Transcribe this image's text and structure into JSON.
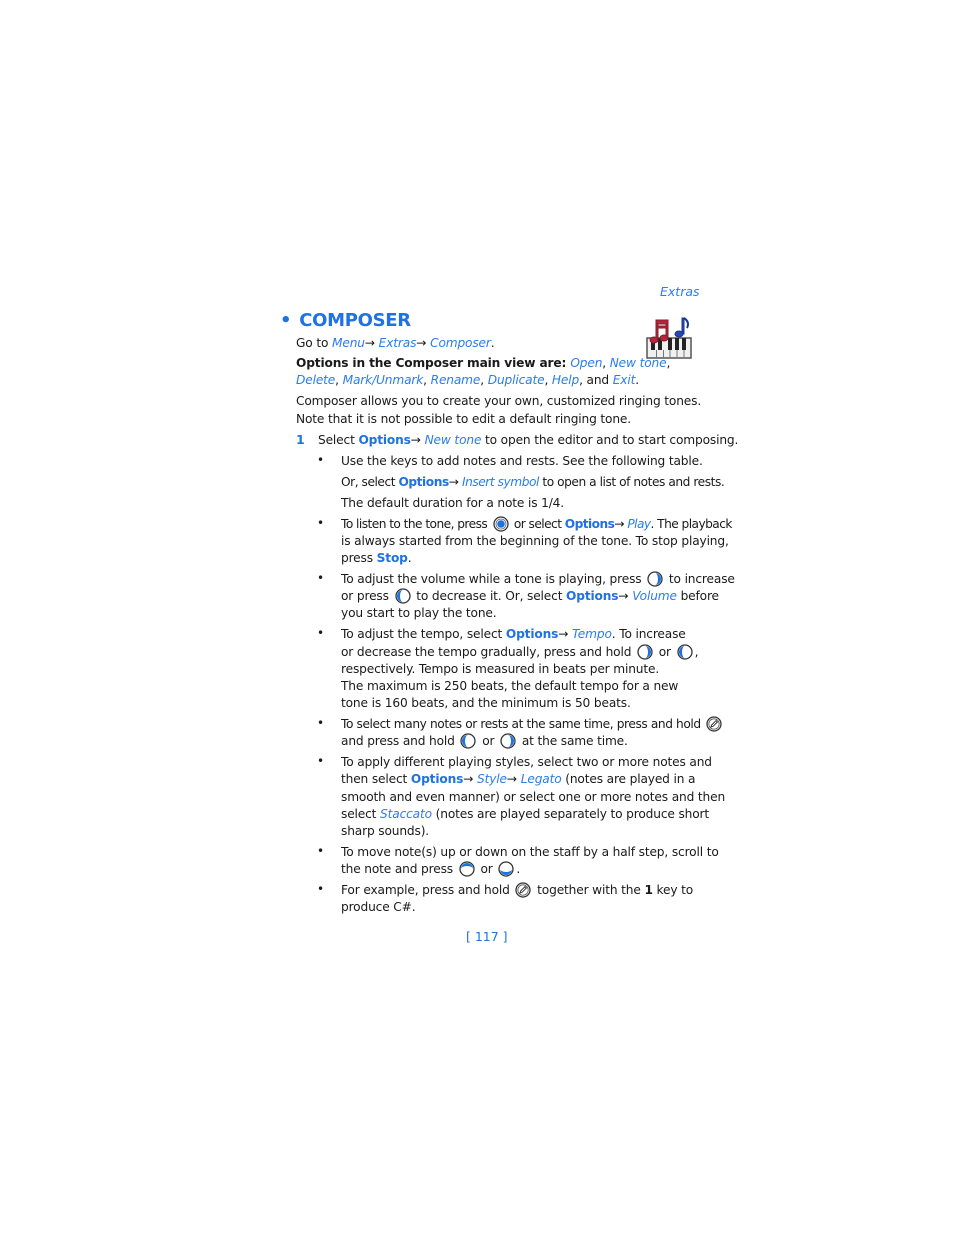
{
  "header": {
    "section": "Extras"
  },
  "title": {
    "bullet": "•",
    "text": "COMPOSER"
  },
  "app_icon": "composer-music-keyboard-icon",
  "goto": {
    "prefix": "Go to ",
    "path": [
      "Menu",
      "Extras",
      "Composer"
    ],
    "arrow": "→",
    "suffix": "."
  },
  "options_intro": {
    "label": "Options in the Composer main view are: ",
    "items": [
      "Open",
      "New tone",
      "Delete",
      "Mark/Unmark",
      "Rename",
      "Duplicate",
      "Help",
      "Exit"
    ],
    "and": "and"
  },
  "intro_paragraph": [
    "Composer allows you to create your own, customized ringing tones.",
    "Note that it is not possible to edit a default ringing tone."
  ],
  "step1": {
    "number": "1",
    "pre": "Select ",
    "options": "Options",
    "arrow": "→ ",
    "item": "New tone",
    "post": " to open the editor and to start composing."
  },
  "bullets": {
    "b1": {
      "l1": "Use the keys to add notes and rests. See the following table.",
      "l2_pre": "Or, select ",
      "l2_options": "Options",
      "l2_item": "Insert symbol",
      "l2_post": " to open a list of notes and rests.",
      "l3": "The default duration for a note is 1/4."
    },
    "b2": {
      "l1_pre": "To listen to the tone, press ",
      "l1_key": "joystick-press-icon",
      "l1_mid": " or select ",
      "l1_options": "Options",
      "l1_item": "Play",
      "l1_post": ". The playback",
      "l2": "is always started from the beginning of the tone. To stop playing,",
      "l3_pre": "press ",
      "l3_stop": "Stop",
      "l3_post": "."
    },
    "b3": {
      "l1_pre": "To adjust the volume while a tone is playing, press ",
      "l1_post": " to increase",
      "l2_pre": "or press ",
      "l2_mid": " to decrease it. Or, select ",
      "l2_options": "Options",
      "l2_item": "Volume",
      "l2_post": " before",
      "l3": "you start to play the tone."
    },
    "b4": {
      "l1_pre": "To adjust the tempo, select ",
      "l1_options": "Options",
      "l1_item": "Tempo",
      "l1_post": ". To increase",
      "l2_pre": "or decrease the tempo gradually, press and hold ",
      "l2_or": " or ",
      "l2_post": ",",
      "l3": "respectively. Tempo is measured in beats per minute.",
      "l4": "The maximum is 250 beats, the default tempo for a new",
      "l5": "tone is 160 beats, and the minimum is 50 beats."
    },
    "b5": {
      "l1_pre": "To select many notes or rests at the same time, press and hold ",
      "l2_pre": "and press and hold ",
      "l2_or": " or ",
      "l2_post": " at the same time."
    },
    "b6": {
      "l1": "To apply different playing styles, select two or more notes and",
      "l2_pre": "then select ",
      "l2_options": "Options",
      "l2_style": "Style",
      "l2_legato": "Legato",
      "l2_post": " (notes are played in a",
      "l3": "smooth and even manner) or select one or more notes and then",
      "l4_pre": "select ",
      "l4_item": "Staccato",
      "l4_post": " (notes are played separately to produce short",
      "l5": "sharp sounds)."
    },
    "b7": {
      "l1": "To move note(s) up or down on the staff by a half step, scroll to",
      "l2_pre": "the note and press ",
      "l2_or": " or ",
      "l2_post": "."
    },
    "b8": {
      "l1_pre": "For example, press and hold ",
      "l1_mid": " together with the ",
      "l1_key": "1",
      "l1_post": " key to",
      "l2": "produce C#."
    }
  },
  "page_number": "[ 117 ]",
  "colors": {
    "accent": "#1f72e0",
    "text": "#1a1a1a"
  }
}
